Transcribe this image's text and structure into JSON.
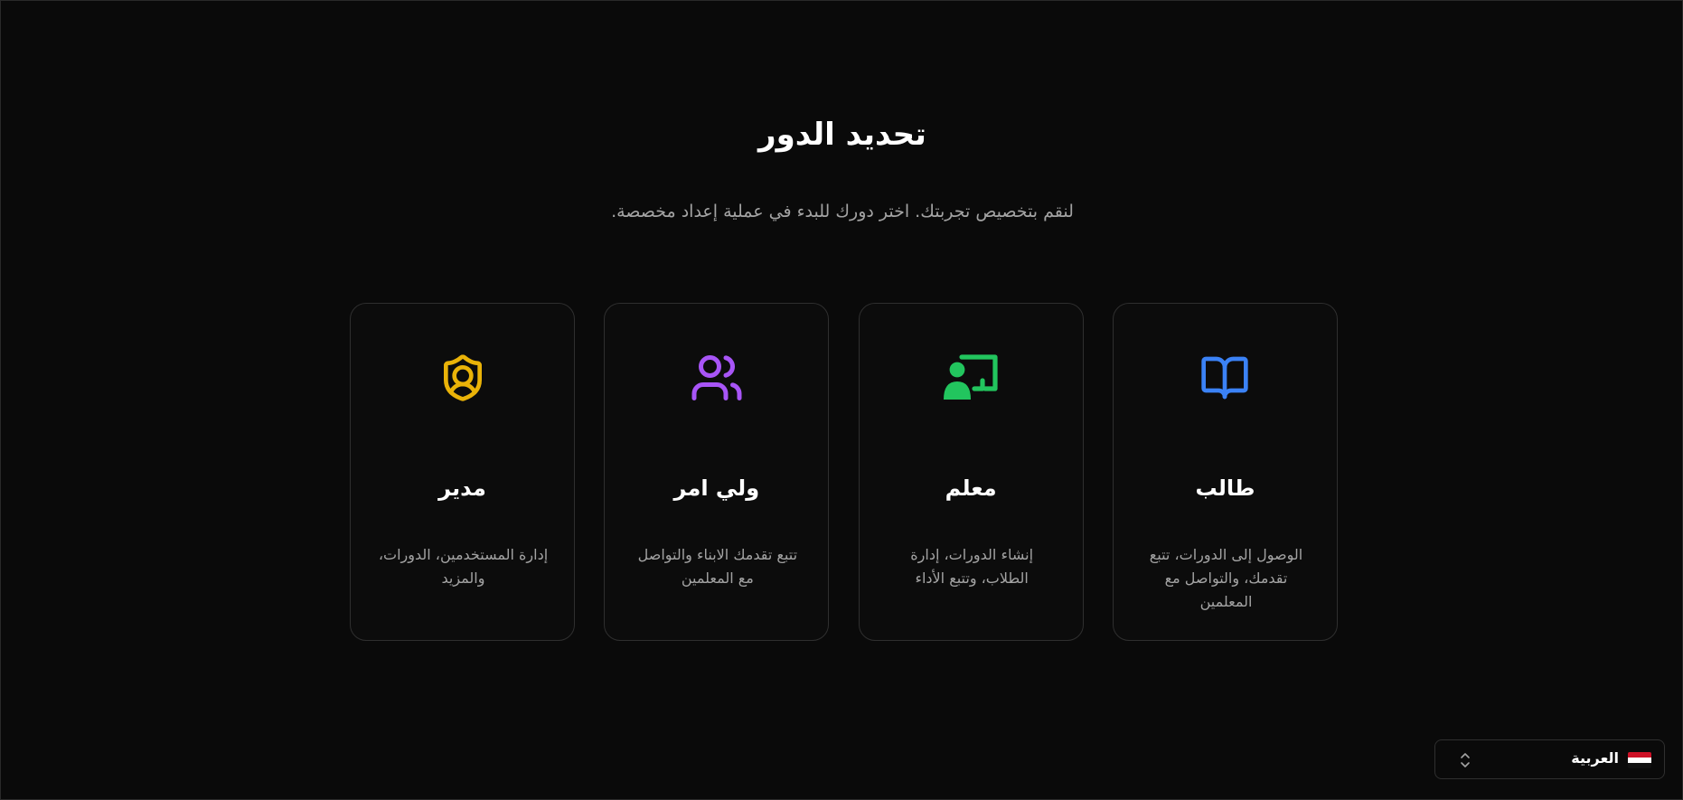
{
  "page": {
    "title": "تحديد الدور",
    "subtitle": "لنقم بتخصيص تجربتك. اختر دورك للبدء في عملية إعداد مخصصة."
  },
  "roles": [
    {
      "name": "طالب",
      "description": "الوصول إلى الدورات، تتبع تقدمك، والتواصل مع المعلمين",
      "icon": "book-open-icon",
      "color": "#3b82f6"
    },
    {
      "name": "معلم",
      "description": "إنشاء الدورات، إدارة الطلاب، وتتبع الأداء",
      "icon": "teacher-board-icon",
      "color": "#22c55e"
    },
    {
      "name": "ولي امر",
      "description": "تتبع تقدمك الابناء والتواصل مع المعلمين",
      "icon": "users-icon",
      "color": "#a855f7"
    },
    {
      "name": "مدير",
      "description": "إدارة المستخدمين، الدورات، والمزيد",
      "icon": "shield-user-icon",
      "color": "#eab308"
    }
  ],
  "language_selector": {
    "selected": "العربية",
    "flag_icon": "egypt-flag-icon",
    "chevron_icon": "chevrons-up-down-icon"
  }
}
